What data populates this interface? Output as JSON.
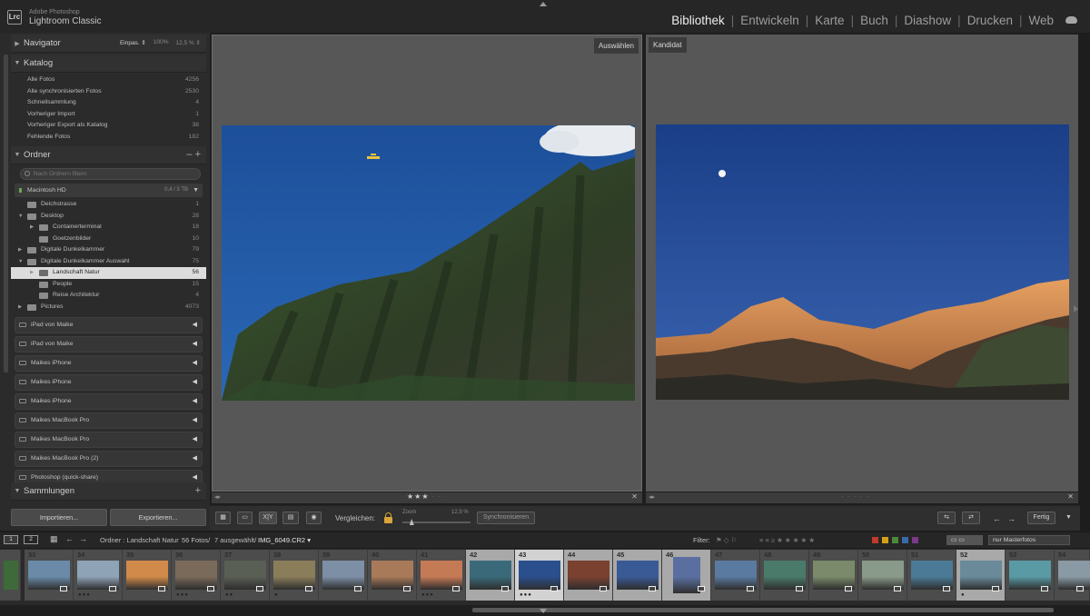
{
  "app": {
    "brand_sub": "Adobe Photoshop",
    "brand_main": "Lightroom Classic",
    "logo_text": "Lrc",
    "modules": [
      "Bibliothek",
      "Entwickeln",
      "Karte",
      "Buch",
      "Diashow",
      "Drucken",
      "Web"
    ],
    "active_module": "Bibliothek"
  },
  "navigator": {
    "title": "Navigator",
    "zoom_options": [
      "Einpas. ⇕",
      "100%",
      "12,5 % ⇕"
    ]
  },
  "catalog": {
    "title": "Katalog",
    "items": [
      {
        "label": "Alle Fotos",
        "count": "4256"
      },
      {
        "label": "Alle synchronisierten Fotos",
        "count": "2530"
      },
      {
        "label": "Schnellsammlung",
        "count": "4"
      },
      {
        "label": "Vorheriger Import",
        "count": "1"
      },
      {
        "label": "Vorheriger Export als Katalog",
        "count": "38"
      },
      {
        "label": "Fehlende Fotos",
        "count": "182"
      }
    ]
  },
  "folders": {
    "title": "Ordner",
    "header_actions": "–  +",
    "search_placeholder": "Nach Ordnern filtern",
    "volume": {
      "name": "Macintosh HD",
      "capacity": "0,4 / 3 TB"
    },
    "items": [
      {
        "name": "Deichstrasse",
        "count": "1",
        "level": 0,
        "expand": ""
      },
      {
        "name": "Desktop",
        "count": "28",
        "level": 0,
        "expand": "▼"
      },
      {
        "name": "Containerterminal",
        "count": "18",
        "level": 1,
        "expand": "▶"
      },
      {
        "name": "Goetzenbilder",
        "count": "10",
        "level": 1,
        "expand": ""
      },
      {
        "name": "Digitale Dunkelkammer",
        "count": "79",
        "level": 0,
        "expand": "▶"
      },
      {
        "name": "Digitale Dunkelkammer Auswahl",
        "count": "75",
        "level": 0,
        "expand": "▼"
      },
      {
        "name": "Landschaft Natur",
        "count": "56",
        "level": 1,
        "expand": "▶",
        "selected": true
      },
      {
        "name": "People",
        "count": "15",
        "level": 1,
        "expand": ""
      },
      {
        "name": "Reise Architektur",
        "count": "4",
        "level": 1,
        "expand": ""
      },
      {
        "name": "Pictures",
        "count": "4073",
        "level": 0,
        "expand": "▶"
      }
    ]
  },
  "devices": [
    "iPad von Maike",
    "iPad von Maike",
    "Maikes iPhone",
    "Maikes iPhone",
    "Maikes iPhone",
    "Maikes MacBook Pro",
    "Maikes MacBook Pro",
    "Maikes MacBook Pro (2)",
    "Photoshop (quick-share)"
  ],
  "collections": {
    "title": "Sammlungen",
    "action": "+"
  },
  "buttons": {
    "import": "Importieren...",
    "export": "Exportieren..."
  },
  "compare": {
    "select_label": "Auswählen",
    "candidate_label": "Kandidat",
    "select_rating_on": "★★★",
    "select_rating_off": "· ·",
    "candidate_rating_off": "· · · · ·"
  },
  "toolbar": {
    "view_xy": "X|Y",
    "compare_label": "Vergleichen:",
    "zoom_label": "Zoom",
    "zoom_value": "12,9 %",
    "zoom_level": 0.13,
    "sync_label": "Synchronisieren",
    "done_label": "Fertig"
  },
  "filmstrip_nav": {
    "screen1": "1",
    "screen2": "2",
    "path_prefix": "Ordner : Landschaft Natur",
    "photo_count": "56 Fotos/",
    "selected_count": "7 ausgewählt/",
    "filename": "IMG_6049.CR2 ▾",
    "filter_label": "Filter:",
    "filter_value": "nur Masterfotos",
    "color_labels": [
      "#c0392b",
      "#d4a017",
      "#4a8a3a",
      "#3a6aa8",
      "#7a3a8a"
    ]
  },
  "filmstrip": {
    "cells": [
      {
        "num": "33",
        "rating": "",
        "tone": "#6a8aa8"
      },
      {
        "num": "34",
        "rating": "●●●",
        "tone": "#8fa3b6"
      },
      {
        "num": "35",
        "rating": "",
        "tone": "#d18a4a"
      },
      {
        "num": "36",
        "rating": "●●●",
        "tone": "#7a6a5a"
      },
      {
        "num": "37",
        "rating": "●●",
        "tone": "#5a5f55"
      },
      {
        "num": "38",
        "rating": "●",
        "tone": "#8a7d5a"
      },
      {
        "num": "39",
        "rating": "",
        "tone": "#7d8fa5"
      },
      {
        "num": "40",
        "rating": "",
        "tone": "#a87a5a"
      },
      {
        "num": "41",
        "rating": "●●●",
        "tone": "#c47a55"
      },
      {
        "num": "42",
        "rating": "",
        "tone": "#3a6a7a"
      },
      {
        "num": "43",
        "rating": "●●●",
        "tone": "#2b4f8c"
      },
      {
        "num": "44",
        "rating": "",
        "tone": "#7a4030"
      },
      {
        "num": "45",
        "rating": "",
        "tone": "#3a5a95"
      },
      {
        "num": "46",
        "rating": "",
        "tone": "#5a6fa0"
      },
      {
        "num": "47",
        "rating": "",
        "tone": "#5a7aa0"
      },
      {
        "num": "48",
        "rating": "",
        "tone": "#4a7a6a"
      },
      {
        "num": "49",
        "rating": "",
        "tone": "#7a8a6a"
      },
      {
        "num": "50",
        "rating": "",
        "tone": "#8a9a8a"
      },
      {
        "num": "51",
        "rating": "",
        "tone": "#4a7a95"
      },
      {
        "num": "52",
        "rating": "●",
        "tone": "#6a8a9a"
      },
      {
        "num": "53",
        "rating": "",
        "tone": "#5a9aa5"
      },
      {
        "num": "54",
        "rating": "",
        "tone": "#8a9aa5"
      }
    ]
  }
}
